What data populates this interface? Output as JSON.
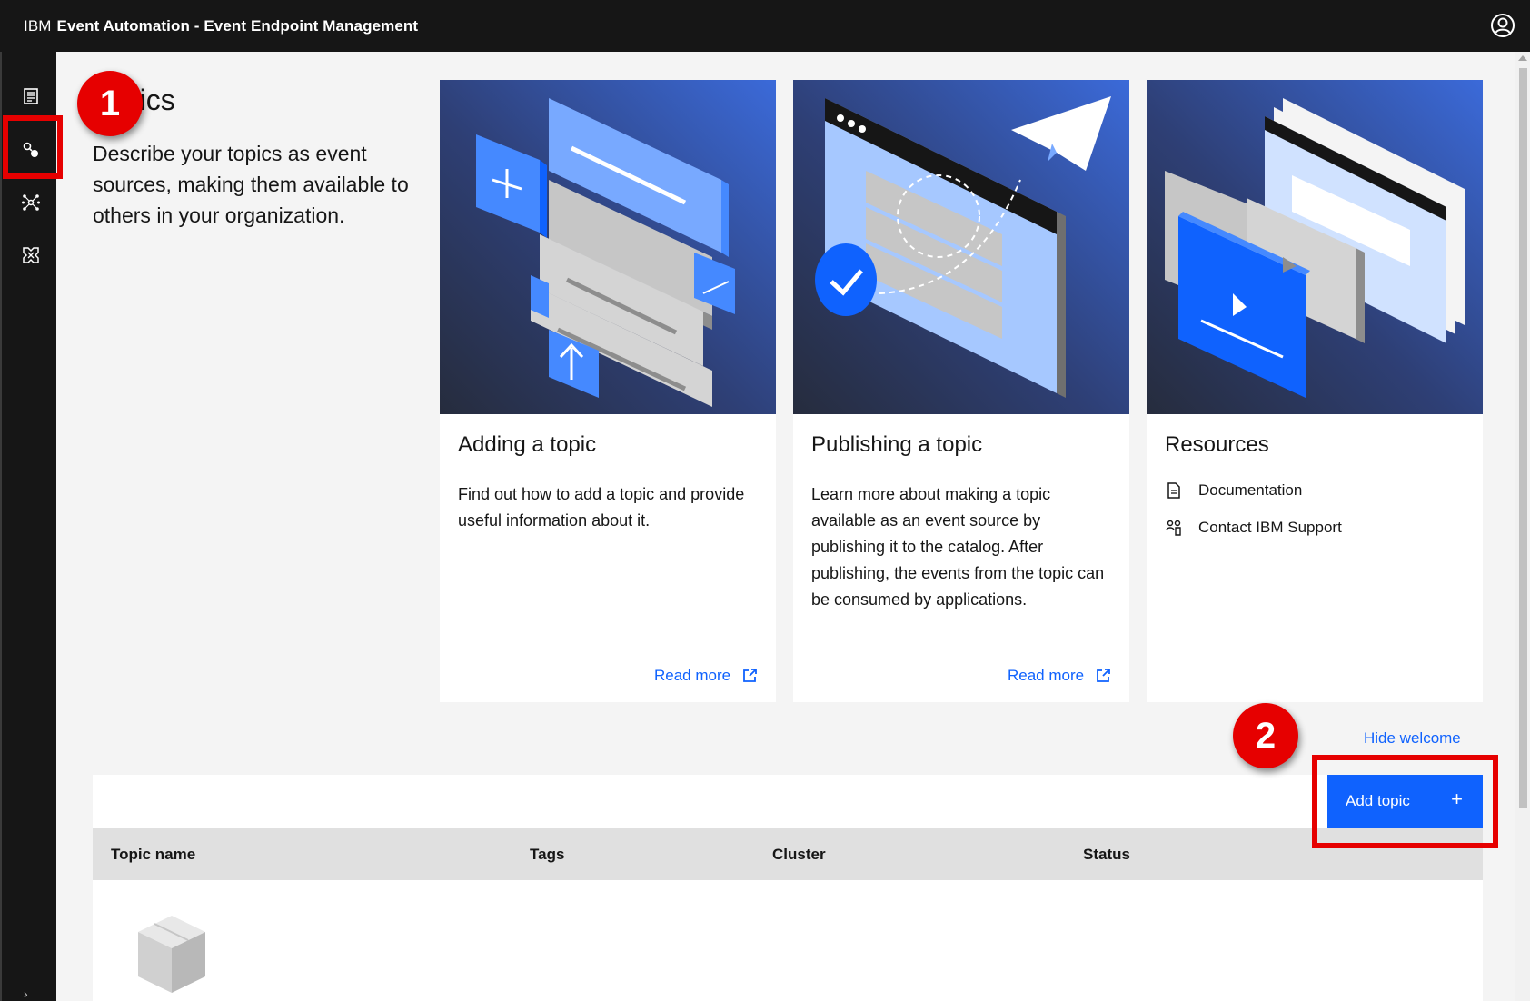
{
  "header": {
    "brand": "IBM",
    "title": "Event Automation - Event Endpoint Management",
    "user_icon": "user-avatar-icon"
  },
  "sidebar": {
    "items": [
      {
        "icon": "catalog-icon"
      },
      {
        "icon": "topics-icon",
        "active": true
      },
      {
        "icon": "event-gateways-icon"
      },
      {
        "icon": "subscriptions-icon"
      }
    ]
  },
  "welcome": {
    "title": "Topics",
    "description": "Describe your topics as event sources, making them available to others in your organization.",
    "hide_label": "Hide welcome"
  },
  "cards": [
    {
      "title": "Adding a topic",
      "text": "Find out how to add a topic and provide useful information about it.",
      "link": "Read more"
    },
    {
      "title": "Publishing a topic",
      "text": "Learn more about making a topic available as an event source by publishing it to the catalog. After publishing, the events from the topic can be consumed by applications.",
      "link": "Read more"
    },
    {
      "title": "Resources",
      "items": [
        {
          "icon": "document-icon",
          "label": "Documentation"
        },
        {
          "icon": "support-icon",
          "label": "Contact IBM Support"
        }
      ]
    }
  ],
  "table": {
    "columns": [
      "Topic name",
      "Tags",
      "Cluster",
      "Status"
    ],
    "add_button": "Add topic",
    "add_icon": "+"
  },
  "annotations": {
    "step1": "1",
    "step2": "2",
    "highlight_color": "#e60000"
  },
  "colors": {
    "primary": "#0f62fe",
    "header_bg": "#161616",
    "page_bg": "#f4f4f4"
  }
}
